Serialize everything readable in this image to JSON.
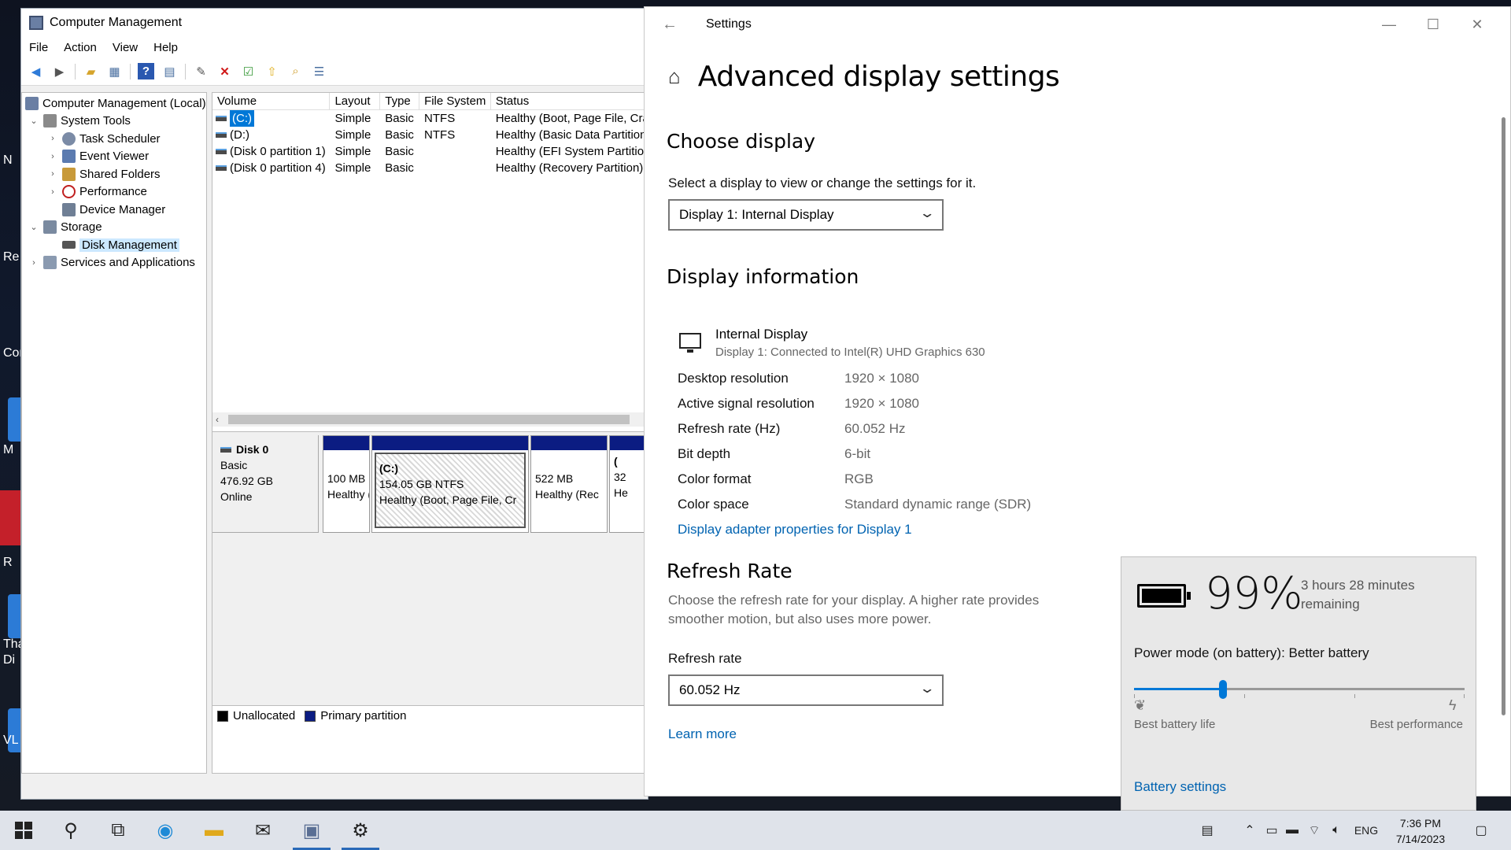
{
  "desktop": {
    "labels": [
      "N",
      "Re",
      "Cor",
      "M",
      "R",
      "Tha",
      "Di",
      "VL"
    ]
  },
  "computer_management": {
    "title": "Computer Management",
    "menu": [
      "File",
      "Action",
      "View",
      "Help"
    ],
    "tree": [
      {
        "label": "Computer Management (Local)",
        "level": 0
      },
      {
        "label": "System Tools",
        "level": 1
      },
      {
        "label": "Task Scheduler",
        "level": 2
      },
      {
        "label": "Event Viewer",
        "level": 2
      },
      {
        "label": "Shared Folders",
        "level": 2
      },
      {
        "label": "Performance",
        "level": 2
      },
      {
        "label": "Device Manager",
        "level": 2
      },
      {
        "label": "Storage",
        "level": 1
      },
      {
        "label": "Disk Management",
        "level": 2
      },
      {
        "label": "Services and Applications",
        "level": 1
      }
    ],
    "volume_columns": [
      "Volume",
      "Layout",
      "Type",
      "File System",
      "Status"
    ],
    "volumes": [
      {
        "volume": "(C:)",
        "layout": "Simple",
        "type": "Basic",
        "fs": "NTFS",
        "status": "Healthy (Boot, Page File, Cra"
      },
      {
        "volume": "(D:)",
        "layout": "Simple",
        "type": "Basic",
        "fs": "NTFS",
        "status": "Healthy (Basic Data Partition"
      },
      {
        "volume": "(Disk 0 partition 1)",
        "layout": "Simple",
        "type": "Basic",
        "fs": "",
        "status": "Healthy (EFI System Partition"
      },
      {
        "volume": "(Disk 0 partition 4)",
        "layout": "Simple",
        "type": "Basic",
        "fs": "",
        "status": "Healthy (Recovery Partition)"
      }
    ],
    "disk": {
      "name": "Disk 0",
      "type": "Basic",
      "size": "476.92 GB",
      "state": "Online"
    },
    "partitions": [
      {
        "line1": "",
        "line2": "100 MB",
        "line3": "Healthy ("
      },
      {
        "line1": "(C:)",
        "line2": "154.05 GB NTFS",
        "line3": "Healthy (Boot, Page File, Cr"
      },
      {
        "line1": "",
        "line2": "522 MB",
        "line3": "Healthy (Rec"
      },
      {
        "line1": "(",
        "line2": "32",
        "line3": "He"
      }
    ],
    "legend": {
      "unallocated": "Unallocated",
      "primary": "Primary partition"
    }
  },
  "settings": {
    "window_title": "Settings",
    "page_title": "Advanced display settings",
    "choose_display": {
      "heading": "Choose display",
      "prompt": "Select a display to view or change the settings for it.",
      "selected": "Display 1: Internal Display"
    },
    "display_info": {
      "heading": "Display information",
      "device_name": "Internal Display",
      "device_sub": "Display 1: Connected to Intel(R) UHD Graphics 630",
      "rows": [
        {
          "key": "Desktop resolution",
          "value": "1920 × 1080"
        },
        {
          "key": "Active signal resolution",
          "value": "1920 × 1080"
        },
        {
          "key": "Refresh rate (Hz)",
          "value": "60.052 Hz"
        },
        {
          "key": "Bit depth",
          "value": "6-bit"
        },
        {
          "key": "Color format",
          "value": "RGB"
        },
        {
          "key": "Color space",
          "value": "Standard dynamic range (SDR)"
        }
      ],
      "adapter_link": "Display adapter properties for Display 1"
    },
    "refresh": {
      "heading": "Refresh Rate",
      "desc_line1": "Choose the refresh rate for your display. A higher rate provides",
      "desc_line2": "smoother motion, but also uses more power.",
      "label": "Refresh rate",
      "selected": "60.052 Hz",
      "learn_more": "Learn more"
    }
  },
  "battery_flyout": {
    "percent": "99%",
    "remaining_line1": "3 hours 28 minutes",
    "remaining_line2": "remaining",
    "power_mode": "Power mode (on battery): Better battery",
    "slider_level": 0.27,
    "left_label": "Best battery life",
    "right_label": "Best performance",
    "settings_link": "Battery settings",
    "accent": "#0078d7"
  },
  "taskbar": {
    "language": "ENG",
    "time": "7:36 PM",
    "date": "7/14/2023"
  }
}
